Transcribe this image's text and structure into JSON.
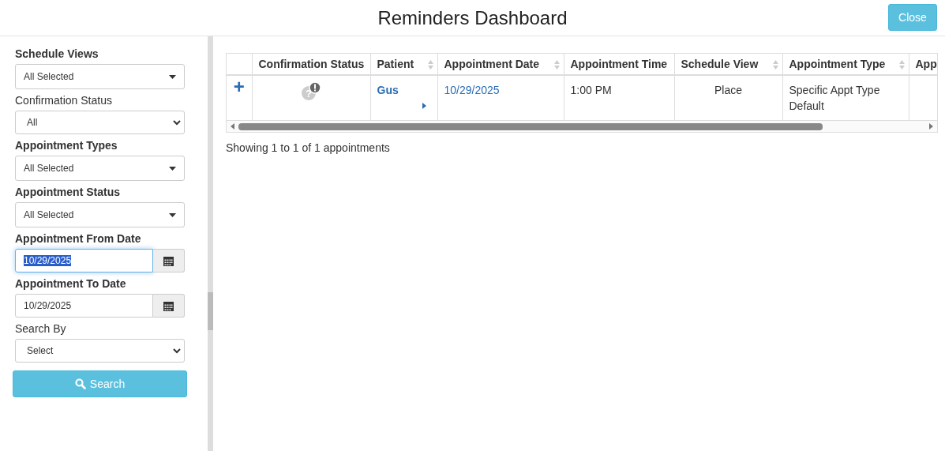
{
  "window": {
    "title": "Reminders Dashboard",
    "close_button": "Close"
  },
  "filters": [
    {
      "label": "Schedule Views",
      "bold": true,
      "kind": "multiselect",
      "value": "All Selected"
    },
    {
      "label": "Confirmation Status",
      "bold": false,
      "kind": "select",
      "value": "All"
    },
    {
      "label": "Appointment Types",
      "bold": true,
      "kind": "multiselect",
      "value": "All Selected"
    },
    {
      "label": "Appointment Status",
      "bold": true,
      "kind": "multiselect",
      "value": "All Selected"
    },
    {
      "label": "Appointment From Date",
      "bold": true,
      "kind": "date",
      "value": "10/29/2025",
      "focused": true
    },
    {
      "label": "Appointment To Date",
      "bold": true,
      "kind": "date",
      "value": "10/29/2025",
      "focused": false
    },
    {
      "label": "Search By",
      "bold": false,
      "kind": "select",
      "value": "Select"
    }
  ],
  "search_button": "Search",
  "table": {
    "columns": [
      {
        "sortable": false
      },
      {
        "label": "Confirmation Status",
        "sortable": false
      },
      {
        "label": "Patient",
        "sortable": true
      },
      {
        "label": "Appointment Date",
        "sortable": true
      },
      {
        "label": "Appointment Time",
        "sortable": false
      },
      {
        "label": "Schedule View",
        "sortable": true
      },
      {
        "label": "Appointment Type",
        "sortable": true
      },
      {
        "label": "App",
        "sortable": false
      }
    ],
    "rows": [
      {
        "expand": "+",
        "status_glyph": "?",
        "patient": "Gus",
        "appointment_date": "10/29/2025",
        "appointment_time": "1:00 PM",
        "schedule_view": "Place",
        "appointment_type": "Specific Appt Type Default"
      }
    ]
  },
  "summary": "Showing 1 to 1 of 1 appointments"
}
